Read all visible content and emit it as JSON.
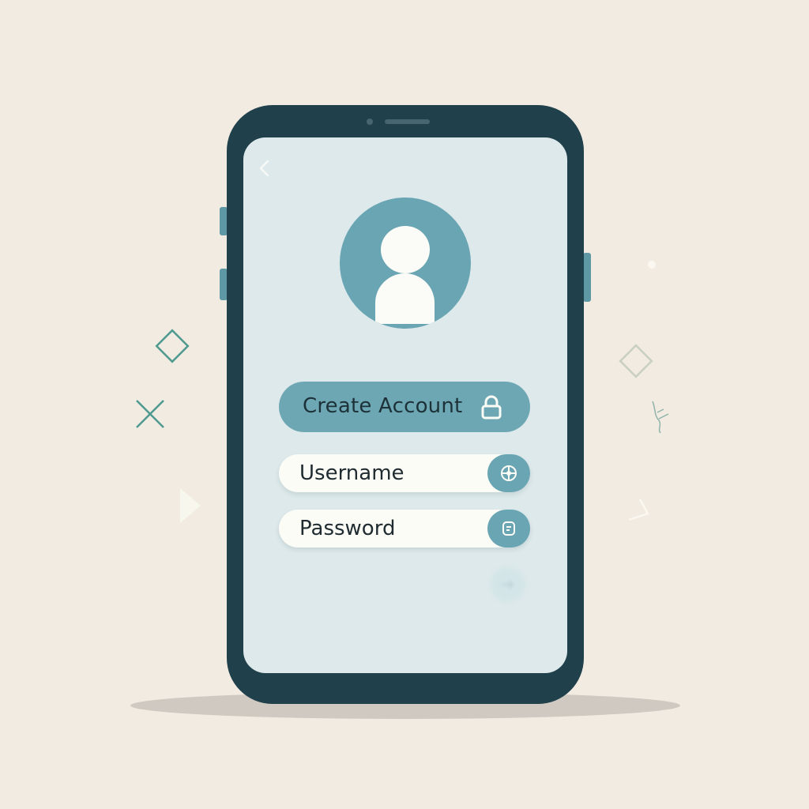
{
  "screen": {
    "back_icon": "chevron-left-icon",
    "avatar_icon": "user-avatar-icon",
    "create_account": {
      "label": "Create Account",
      "icon": "lock-icon"
    },
    "fields": [
      {
        "value": "Username",
        "icon": "globe-icon"
      },
      {
        "value": "Password",
        "icon": "key-icon"
      }
    ],
    "faded_icon": "arrow-icon"
  },
  "colors": {
    "background": "#f2ebe1",
    "phone_frame": "#20404b",
    "screen": "#dde9eb",
    "accent": "#6ea7b4",
    "field": "#fbfcf6"
  }
}
